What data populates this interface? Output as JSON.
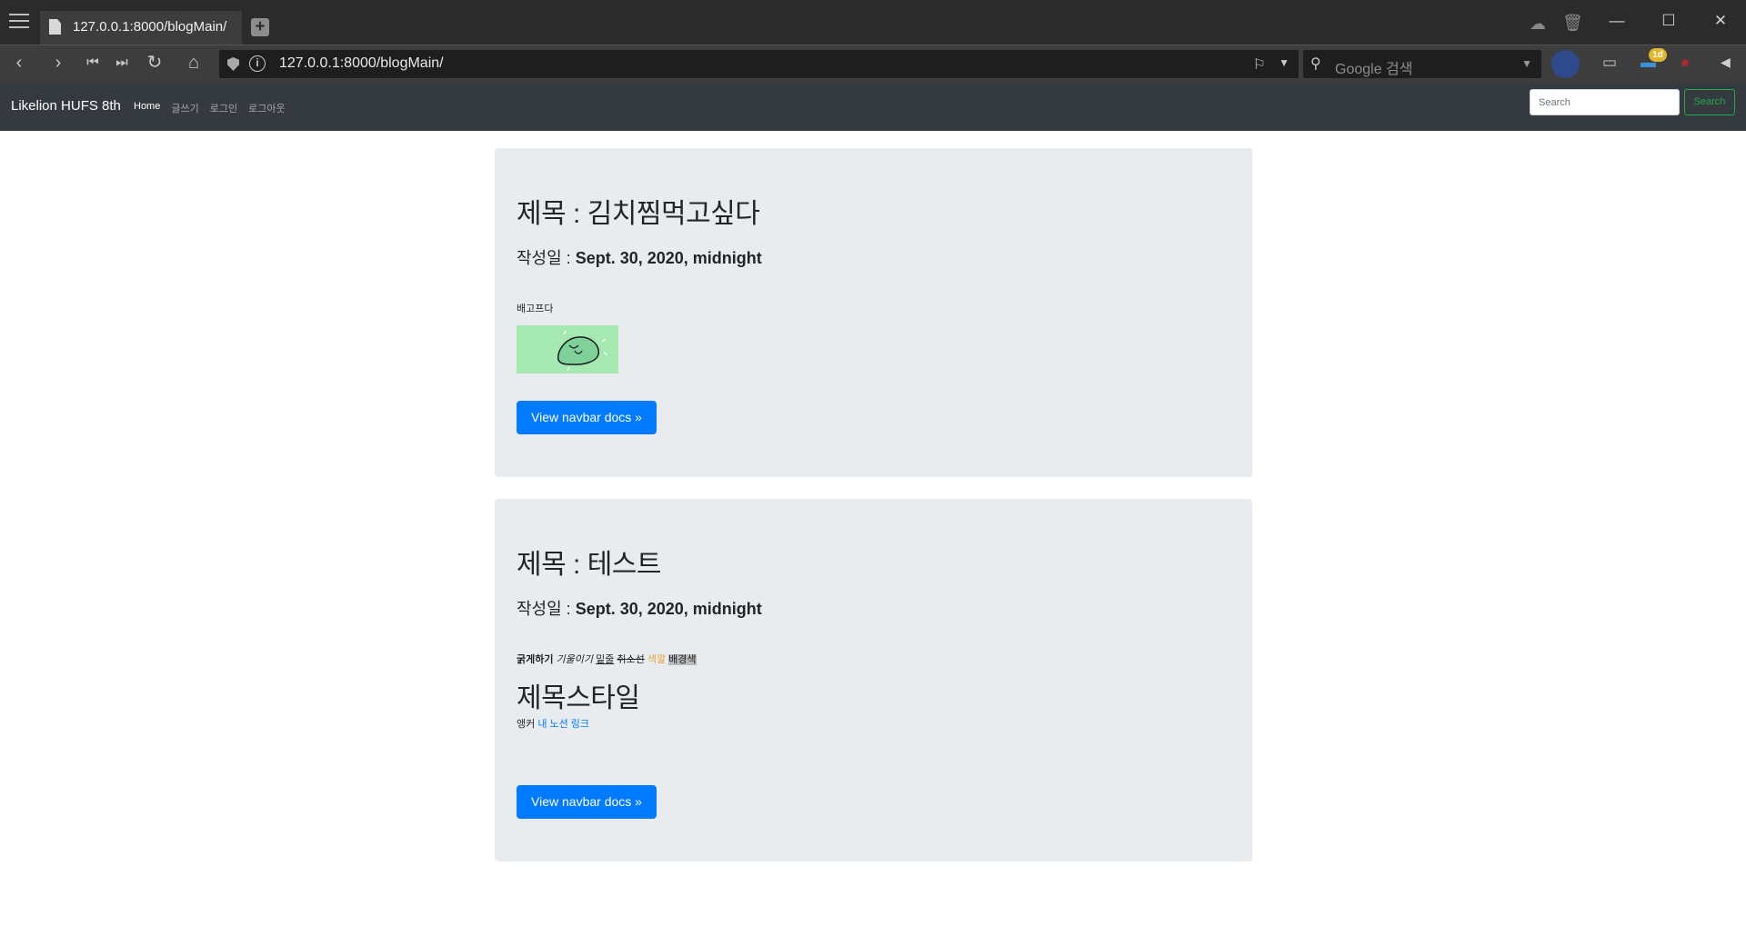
{
  "browser": {
    "tab_title": "127.0.0.1:8000/blogMain/",
    "url": "127.0.0.1:8000/blogMain/",
    "search_placeholder": "Google 검색",
    "extension_badge": "1d"
  },
  "site": {
    "brand": "Likelion HUFS 8th",
    "nav": [
      {
        "label": "Home",
        "active": true
      },
      {
        "label": "글쓰기",
        "active": false
      },
      {
        "label": "로그인",
        "active": false
      },
      {
        "label": "로그아웃",
        "active": false
      }
    ],
    "search_placeholder": "Search",
    "search_button": "Search"
  },
  "posts": [
    {
      "title": "제목 : 김치찜먹고싶다",
      "date_label": "작성일 : ",
      "date": "Sept. 30, 2020, midnight",
      "body": "배고프다",
      "button": "View navbar docs »"
    },
    {
      "title": "제목 : 테스트",
      "date_label": "작성일 : ",
      "date": "Sept. 30, 2020, midnight",
      "body_parts": {
        "bold": "굵게하기",
        "italic": "기울이기",
        "underline": "밑줄",
        "strike": "취소선",
        "color": "색깔",
        "background": "배경색"
      },
      "heading": "제목스타일",
      "anchor_label": "앵커",
      "anchor_link": "내 노션 링크",
      "button": "View navbar docs »"
    }
  ],
  "colors": {
    "navbar": "#343a40",
    "card": "#e9ecef",
    "primary": "#007bff",
    "success": "#28a745"
  }
}
